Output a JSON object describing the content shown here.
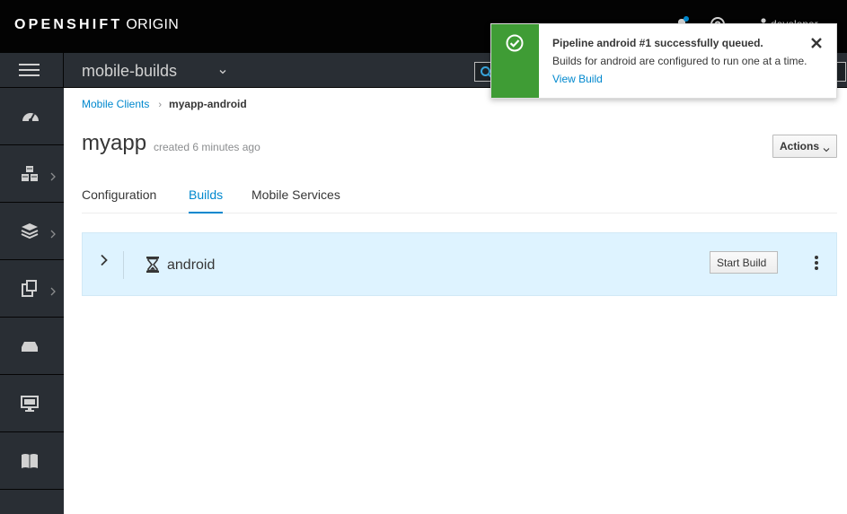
{
  "brand": {
    "bold": "OPENSHIFT",
    "light": "ORIGIN"
  },
  "header": {
    "user": "developer"
  },
  "project": {
    "name": "mobile-builds"
  },
  "sidebar": {
    "items": [
      {
        "icon": "dashboard-icon"
      },
      {
        "icon": "applications-icon"
      },
      {
        "icon": "builds-icon"
      },
      {
        "icon": "resources-icon"
      },
      {
        "icon": "storage-icon"
      },
      {
        "icon": "monitoring-icon"
      },
      {
        "icon": "catalog-icon"
      }
    ]
  },
  "breadcrumb": {
    "parent": "Mobile Clients",
    "current": "myapp-android"
  },
  "page": {
    "title": "myapp",
    "created": "created 6 minutes ago",
    "actions": "Actions"
  },
  "tabs": [
    {
      "label": "Configuration",
      "active": false
    },
    {
      "label": "Builds",
      "active": true
    },
    {
      "label": "Mobile Services",
      "active": false
    }
  ],
  "build": {
    "name": "android",
    "start_label": "Start Build"
  },
  "toast": {
    "title": "Pipeline android #1 successfully queued.",
    "message": "Builds for android are configured to run one at a time.",
    "link": "View Build"
  },
  "colors": {
    "accent": "#0088ce",
    "success": "#3f9c35",
    "nav": "#292e34",
    "topbar": "#030303"
  }
}
